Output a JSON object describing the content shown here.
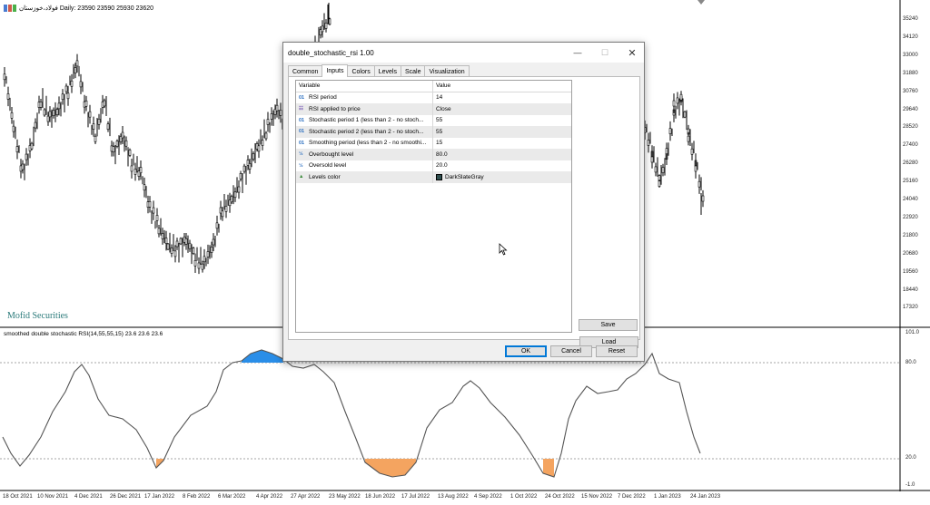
{
  "chart": {
    "header": "فولاد،خوزستان Daily: 23590 23590 25930 23620",
    "watermark": "Mofid Securities",
    "price_axis": [
      "35240",
      "34120",
      "33000",
      "31880",
      "30760",
      "29640",
      "28520",
      "27400",
      "26280",
      "25160",
      "24040",
      "22920",
      "21800",
      "20680",
      "19560",
      "18440",
      "17320"
    ],
    "oscillator_header": "smoothed double stochastic RSI(14,55,55,15) 23.6 23.6 23.6",
    "oscillator_axis": [
      "101.0",
      "80.0",
      "20.0",
      "-1.0"
    ],
    "dates": [
      "18 Oct 2021",
      "10 Nov 2021",
      "4 Dec 2021",
      "26 Dec 2021",
      "17 Jan 2022",
      "8 Feb 2022",
      "6 Mar 2022",
      "4 Apr 2022",
      "27 Apr 2022",
      "23 May 2022",
      "18 Jun 2022",
      "17 Jul 2022",
      "13 Aug 2022",
      "4 Sep 2022",
      "1 Oct 2022",
      "24 Oct 2022",
      "15 Nov 2022",
      "7 Dec 2022",
      "1 Jan 2023",
      "24 Jan 2023"
    ],
    "colors": {
      "overbought_fill": "#2a8ee8",
      "oversold_fill": "#f4a460",
      "levels": "#2f4f4f"
    }
  },
  "dialog": {
    "title": "double_stochastic_rsi 1.00",
    "tabs": [
      "Common",
      "Inputs",
      "Colors",
      "Levels",
      "Scale",
      "Visualization"
    ],
    "active_tab": "Inputs",
    "columns": {
      "variable": "Variable",
      "value": "Value"
    },
    "rows": [
      {
        "icon": "01",
        "variable": "RSI period",
        "value": "14"
      },
      {
        "icon": "enum-icon",
        "variable": "RSI applied to price",
        "value": "Close"
      },
      {
        "icon": "01",
        "variable": "Stochastic period 1 (less than 2 - no stoch...",
        "value": "55"
      },
      {
        "icon": "01",
        "variable": "Stochastic period 2 (less than 2 - no stoch...",
        "value": "55"
      },
      {
        "icon": "01",
        "variable": "Smoothing period (less than 2 - no smoothi...",
        "value": "15"
      },
      {
        "icon": "½",
        "variable": "Overbought level",
        "value": "80.0"
      },
      {
        "icon": "½",
        "variable": "Oversold level",
        "value": "20.0"
      },
      {
        "icon": "color-icon",
        "variable": "Levels color",
        "value": "DarkSlateGray"
      }
    ],
    "buttons": {
      "load": "Load",
      "save": "Save",
      "ok": "OK",
      "cancel": "Cancel",
      "reset": "Reset"
    }
  }
}
